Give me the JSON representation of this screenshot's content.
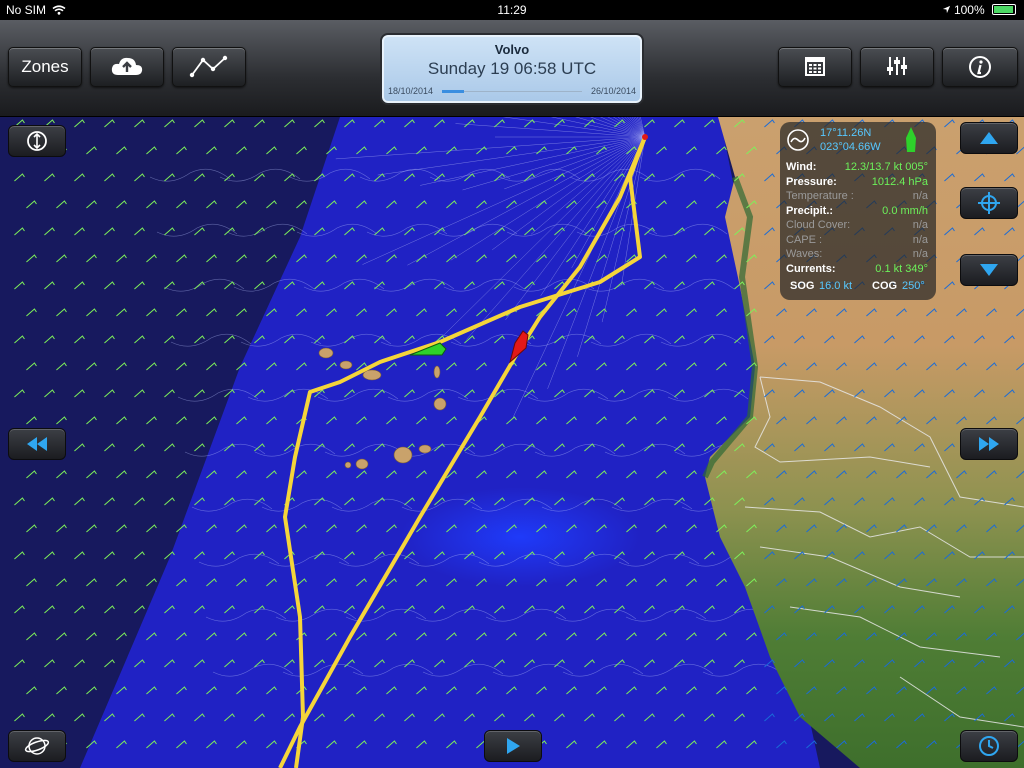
{
  "status_bar": {
    "carrier": "No SIM",
    "time": "11:29",
    "battery": "100%"
  },
  "toolbar": {
    "zones_label": "Zones",
    "panel": {
      "title": "Volvo",
      "datetime": "Sunday 19 06:58 UTC",
      "range_start": "18/10/2014",
      "range_end": "26/10/2014",
      "progress": 0.16
    },
    "icons": [
      "cloud-upload-icon",
      "route-icon",
      "calendar-icon",
      "settings-sliders-icon",
      "info-icon"
    ]
  },
  "info_panel": {
    "latitude": "17°11.26N",
    "longitude": "023°04.66W",
    "rows": [
      {
        "label": "Wind:",
        "value": "12.3/13.7 kt 005°",
        "active": true
      },
      {
        "label": "Pressure:",
        "value": "1012.4 hPa",
        "active": true
      },
      {
        "label": "Temperature :",
        "value": "n/a",
        "active": false
      },
      {
        "label": "Precipit.:",
        "value": "0.0 mm/h",
        "active": true
      },
      {
        "label": "Cloud Cover:",
        "value": "n/a",
        "active": false
      },
      {
        "label": "CAPE :",
        "value": "n/a",
        "active": false
      },
      {
        "label": "Waves:",
        "value": "n/a",
        "active": false
      },
      {
        "label": "Currents:",
        "value": "0.1 kt 349°",
        "active": true
      }
    ],
    "sog_label": "SOG",
    "sog_value": "16.0 kt",
    "cog_label": "COG",
    "cog_value": "250°"
  },
  "colors": {
    "ocean": "#1c1fb0",
    "route": "#f5d53a",
    "boat_green": "#2ed12b",
    "boat_red": "#e31818",
    "wind_barb": "#7ef05a",
    "coord_blue": "#57c8ff"
  }
}
